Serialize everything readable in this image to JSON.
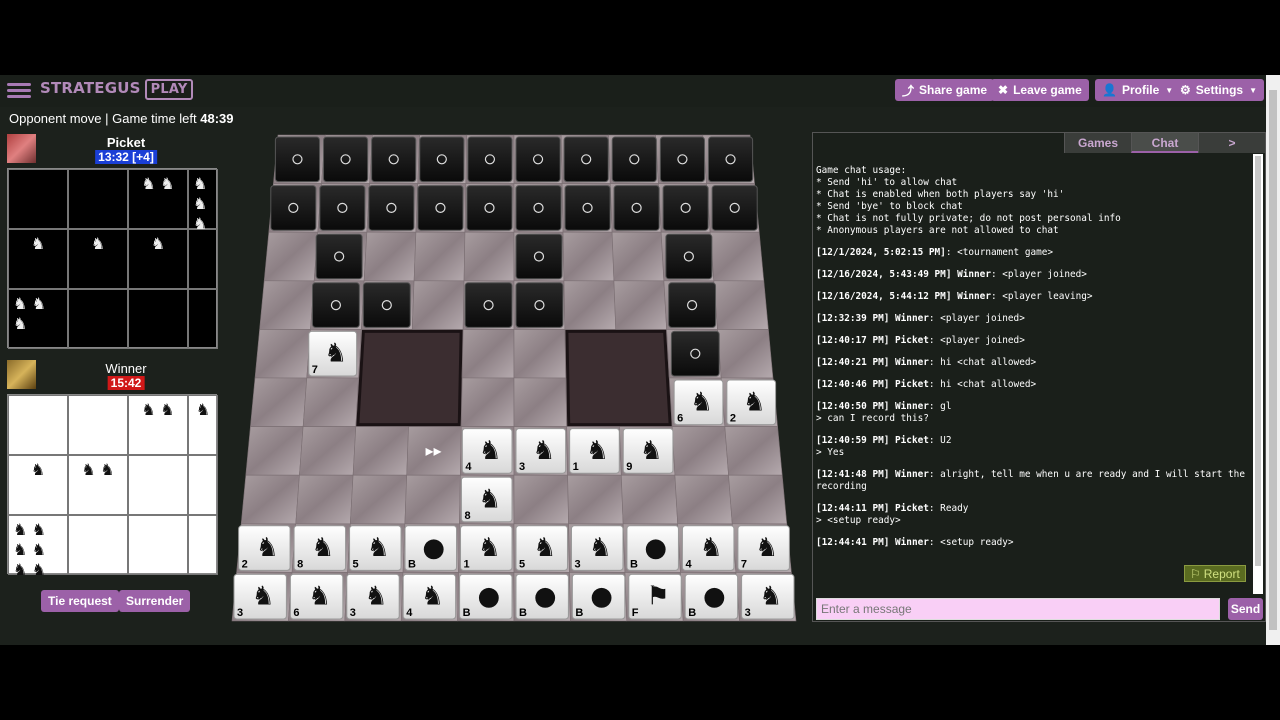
{
  "header": {
    "logo_text": "STRATEGUS",
    "logo_badge": "PLAY",
    "share_label": "Share game",
    "leave_label": "Leave game",
    "profile_label": "Profile",
    "settings_label": "Settings"
  },
  "status": {
    "prefix": "Opponent move | Game time left ",
    "time": "48:39"
  },
  "players": {
    "opponent": {
      "name": "Picket",
      "clock": "13:32 [+4]",
      "clock_color": "#1a3fd6"
    },
    "me": {
      "name": "Winner",
      "clock": "15:42",
      "clock_color": "#d01818"
    }
  },
  "captured": {
    "opponent": [
      "",
      "",
      "♞ ♞",
      "♞ ♞ ♞",
      "♞",
      "♞",
      "♞",
      "",
      "♞ ♞ ♞",
      "",
      "",
      ""
    ],
    "me": [
      "",
      "",
      "♞ ♞",
      "♞",
      "♞",
      "♞ ♞",
      "",
      "",
      "♞ ♞ ♞ ♞ ♞ ♞",
      "",
      "",
      ""
    ]
  },
  "buttons": {
    "tie": "Tie request",
    "surrender": "Surrender"
  },
  "board": {
    "rows": [
      [
        "o",
        "o",
        "o",
        "o",
        "o",
        "o",
        "o",
        "o",
        "o",
        "o"
      ],
      [
        "o",
        "o",
        "o",
        "o",
        "o",
        "o",
        "o",
        "o",
        "o",
        "o"
      ],
      [
        "",
        "o",
        "",
        "",
        "",
        "o",
        "",
        "",
        "o",
        ""
      ],
      [
        "",
        "o",
        "o",
        "",
        "o",
        "o",
        "",
        "",
        "o",
        ""
      ],
      [
        "",
        "7",
        "L",
        "L",
        "",
        "",
        "L",
        "L",
        "o",
        ""
      ],
      [
        "",
        "",
        "L",
        "L",
        "",
        "",
        "L",
        "L",
        "6",
        "2"
      ],
      [
        "",
        "",
        "",
        "»",
        "4",
        "3",
        "1",
        "9",
        "",
        ""
      ],
      [
        "",
        "",
        "",
        "",
        "8",
        "",
        "",
        "",
        "",
        ""
      ],
      [
        "2",
        "8",
        "5",
        "B",
        "1",
        "5",
        "3",
        "B",
        "4",
        "7"
      ],
      [
        "3",
        "6",
        "3",
        "4",
        "B",
        "B",
        "B",
        "F",
        "B",
        "3"
      ]
    ]
  },
  "tabs": [
    "Games",
    "Chat",
    ">"
  ],
  "chat": {
    "intro": [
      "Game chat usage:",
      "* Send 'hi' to allow chat",
      "* Chat is enabled when both players say 'hi'",
      "* Send 'bye' to block chat",
      "* Chat is not fully private; do not post personal info",
      "* Anonymous players are not allowed to chat"
    ],
    "messages": [
      {
        "ts": "[12/1/2024, 5:02:15 PM]",
        "who": "",
        "text": ": <tournament game>"
      },
      {
        "ts": "[12/16/2024, 5:43:49 PM] Winner",
        "who": "",
        "text": ": <player joined>"
      },
      {
        "ts": "[12/16/2024, 5:44:12 PM] Winner",
        "who": "",
        "text": ": <player leaving>"
      },
      {
        "ts": "[12:32:39 PM] Winner",
        "who": "",
        "text": ": <player joined>"
      },
      {
        "ts": "[12:40:17 PM] Picket",
        "who": "",
        "text": ": <player joined>"
      },
      {
        "ts": "[12:40:21 PM] Winner",
        "who": "",
        "text": ": hi <chat allowed>"
      },
      {
        "ts": "[12:40:46 PM] Picket",
        "who": "",
        "text": ": hi <chat allowed>"
      },
      {
        "ts": "[12:40:50 PM] Winner",
        "who": "",
        "text": ": gl\n> can I record this?"
      },
      {
        "ts": "[12:40:59 PM] Picket",
        "who": "",
        "text": ": U2\n> Yes"
      },
      {
        "ts": "[12:41:48 PM] Winner",
        "who": "",
        "text": ": alright, tell me when u are ready and I will start the\nrecording"
      },
      {
        "ts": "[12:44:11 PM] Picket",
        "who": "",
        "text": ": Ready\n> <setup ready>"
      },
      {
        "ts": "[12:44:41 PM] Winner",
        "who": "",
        "text": ": <setup ready>"
      }
    ],
    "report_label": "Report",
    "input_placeholder": "Enter a message",
    "send_label": "Send"
  }
}
